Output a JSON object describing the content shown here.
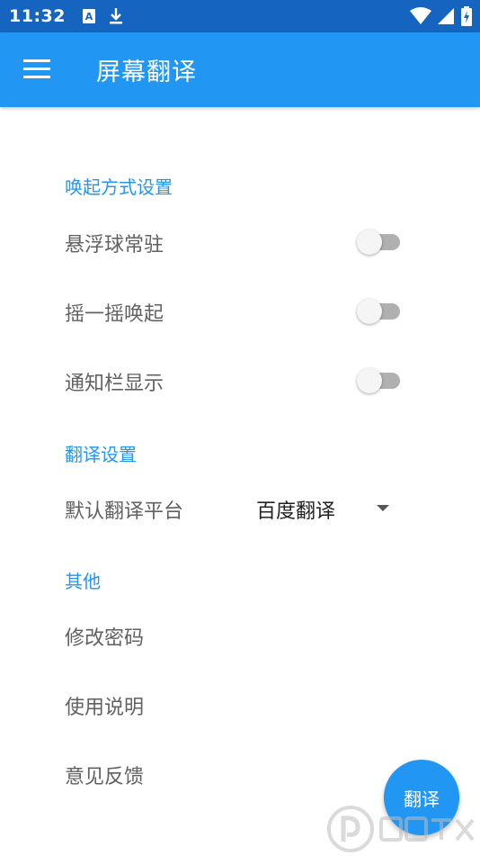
{
  "status_bar": {
    "time": "11:32"
  },
  "app_bar": {
    "title": "屏幕翻译"
  },
  "sections": {
    "wake": {
      "header": "唤起方式设置",
      "items": [
        {
          "label": "悬浮球常驻",
          "enabled": false
        },
        {
          "label": "摇一摇唤起",
          "enabled": false
        },
        {
          "label": "通知栏显示",
          "enabled": false
        }
      ]
    },
    "translate": {
      "header": "翻译设置",
      "platform_label": "默认翻译平台",
      "platform_value": "百度翻译"
    },
    "other": {
      "header": "其他",
      "items": [
        "修改密码",
        "使用说明",
        "意见反馈"
      ]
    }
  },
  "fab": {
    "label": "翻译"
  },
  "colors": {
    "status_bar": "#1565c0",
    "app_bar": "#2196f3",
    "accent": "#2196f3",
    "label": "#616161"
  }
}
